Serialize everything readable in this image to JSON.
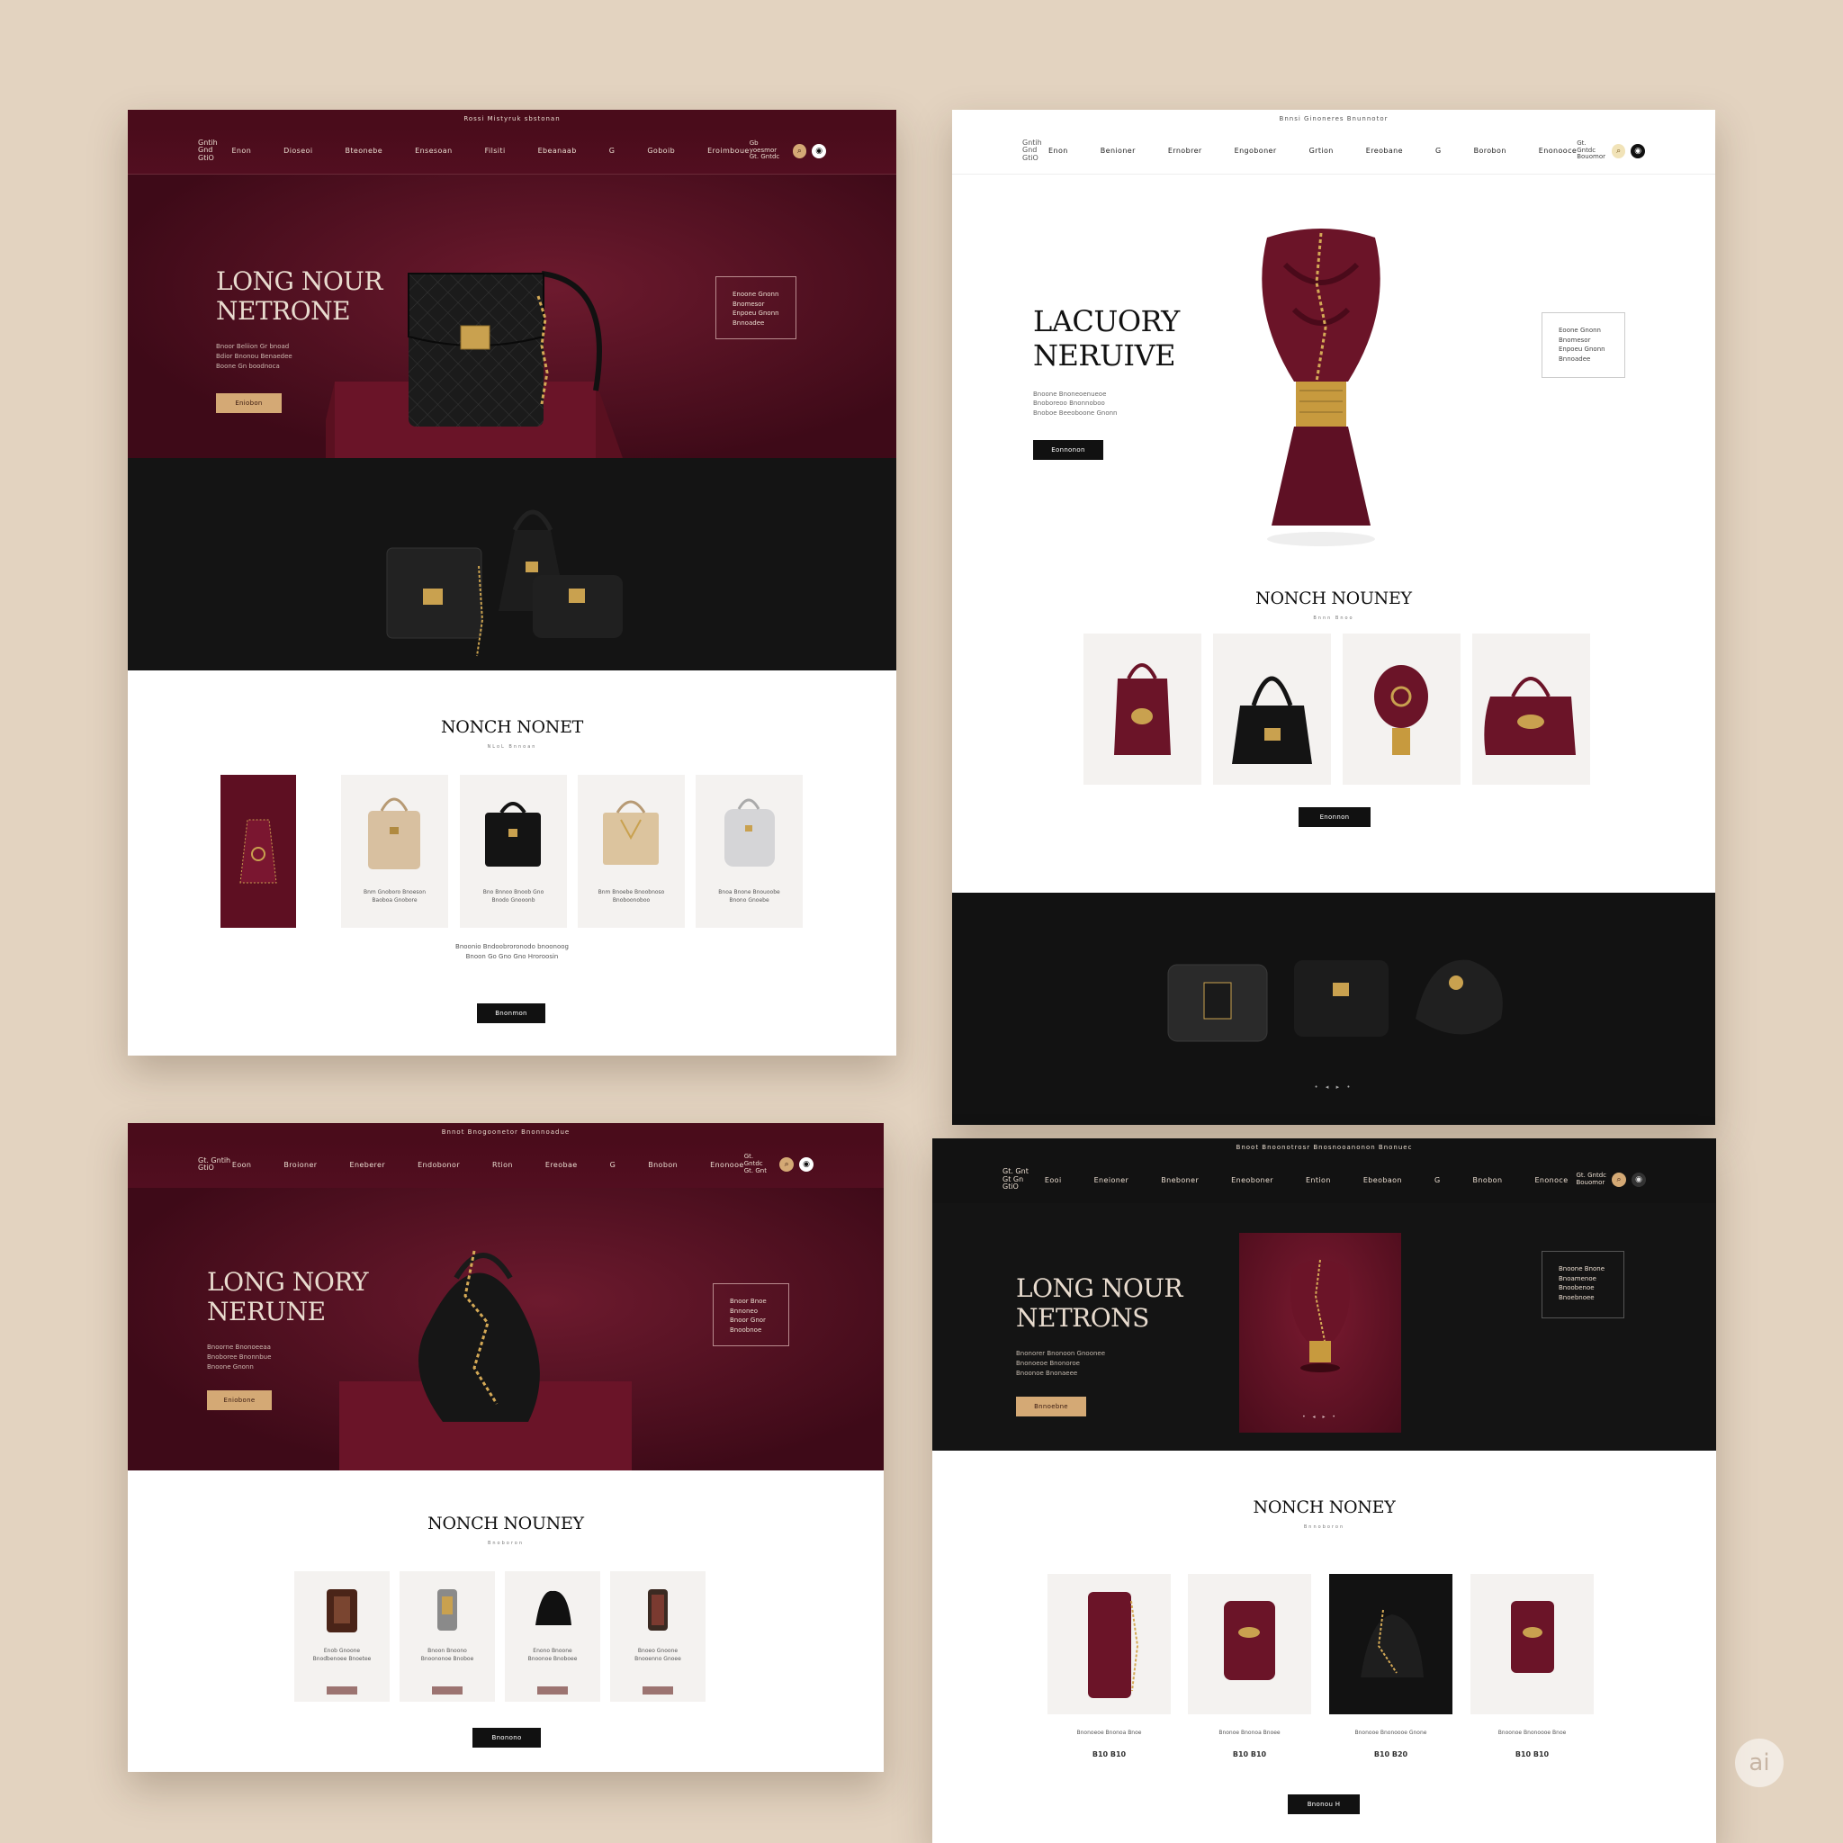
{
  "mockups": [
    {
      "id": "m1",
      "topbar": "Rossi Mistyruk sbstonan",
      "logo": "Gntih\nGnd\nGtiO",
      "nav": [
        "Enon",
        "Dioseoi",
        "Bteonebe",
        "Ensesoan",
        "Filsiti",
        "Ebeanaab",
        "G",
        "Goboib",
        "Eroimboue"
      ],
      "utils": "Gb yoesmor\nGt. Gntdc",
      "hero": {
        "title": "LONG NOUR\nNETRONE",
        "sub": "Bnoor Beliion Gr bnoad\nBdior Bnonou Benaedee\nBoone Gn boodnoca",
        "cta": "Eniobon",
        "info": "Enoone Gnonn\nBnomesor\nEnpoeu Gnonn\nBnnoadee"
      },
      "section": {
        "title": "NONCH NONET",
        "sub": "NLoL Bnnoan",
        "desc": "Bnoonio Bndoobroronodo bnoonoog\nBnoon Go Gno Gno Hroroosin",
        "cta": "Bnonmon"
      },
      "captions": [
        "Bnm Gnoboro Bnoeson\nBaoboa Gnobore",
        "Bno Bnnoo Bnoob Gno\nBnodo Gnooonb",
        "Bnm Bnoebe Bnoobnoso\nBnoboonoboo",
        "Bnoa Bnone Bnouoobe\nBnono Gnoebe"
      ]
    },
    {
      "id": "m2",
      "topbar": "Bnnsi Ginoneres Bnunnotor",
      "logo": "Gntih\nGnd\nGtiO",
      "nav": [
        "Enon",
        "Benioner",
        "Ernobrer",
        "Engoboner",
        "Grtion",
        "Ereobane",
        "G",
        "Borobon",
        "Enonooce"
      ],
      "utils": "Gt. Gntdc\nBouomor",
      "hero": {
        "title": "LACUORY\nNERUIVE",
        "sub": "Bnoone Bnoneoenueoe\nBnoboreoo Bnonnoboo\nBnoboe Beeoboone Gnonn",
        "cta": "Eonnonon",
        "info": "Eoone Gnonn\nBnomesor\nEnpoeu Gnonn\nBnnoadee"
      },
      "section": {
        "title": "NONCH NOUNEY",
        "sub": "Bnnn Bnoo",
        "cta": "Enonnon"
      },
      "dots": "• ◂ ▸ •"
    },
    {
      "id": "m3",
      "topbar": "Bnnot Bnogoonetor Bnonnoadue",
      "logo": "Gt. Gntih\nGtiO",
      "nav": [
        "Eoon",
        "Broioner",
        "Eneberer",
        "Endobonor",
        "Rtion",
        "Ereobae",
        "G",
        "Bnobon",
        "Enonooe"
      ],
      "utils": "Gt. Gntdc\nGt. Gnt",
      "hero": {
        "title": "LONG NORY\nNERUNE",
        "sub": "Bnoorne Bnonoeeaa\nBnoboree Bnonnbue\nBnoone Gnonn",
        "cta": "Eniobone",
        "info": "Bnoor Bnoe\nBnnoneo\nBnoor Gnor\nBnoobnoe"
      },
      "section": {
        "title": "NONCH NOUNEY",
        "sub": "Bnoboron",
        "cta": "Bnonono"
      },
      "captions": [
        "Enob Gnoone\nBnodbenoee Bnoetee",
        "Bnoon Bnoono\nBnoononoe Bnoboe",
        "Enono Bnoone\nBnoonoe Bnoboee",
        "Bnoeo Gnoone\nBnooenno Gnoee"
      ]
    },
    {
      "id": "m4",
      "topbar": "Bnoot Bnoonotrosr Bnosnooanonon Bnonuec",
      "logo": "Gt. Gnt\nGt Gn\nGtiO",
      "nav": [
        "Eooi",
        "Eneioner",
        "Bneboner",
        "Eneoboner",
        "Ention",
        "Ebeobaon",
        "G",
        "Bnobon",
        "Enonoce"
      ],
      "utils": "Gt. Gntdc\nBouomor",
      "hero": {
        "title": "LONG NOUR\nNETRONS",
        "sub": "Bnonorer Bnonoon Gnoonee\nBnonoeoe Bnonoroe\nBnoonoe Bnonaeee",
        "cta": "Bnnoebne",
        "info": "Bnoone Bnone\nBnoamenoe\nBnoobenoe\nBnoebnoee"
      },
      "section": {
        "title": "NONCH NONEY",
        "sub": "Bnnoboron",
        "cta": "Bnonou H"
      },
      "captions": [
        "Bnonoeoe Bnonoa Bnoe",
        "Bnonoe Bnonoa Bnoee",
        "Bnonooe Bnonoooe Gnone",
        "Bnoonoe Bnonoooe Bnoe"
      ],
      "prices": [
        "B10 B10",
        "B10 B10",
        "B10 B20",
        "B10 B10"
      ]
    }
  ],
  "badge": "ai",
  "colors": {
    "burgundy": "#5a0f22",
    "black": "#121212",
    "gold": "#d4a975",
    "backdrop": "#e3d3c0"
  }
}
